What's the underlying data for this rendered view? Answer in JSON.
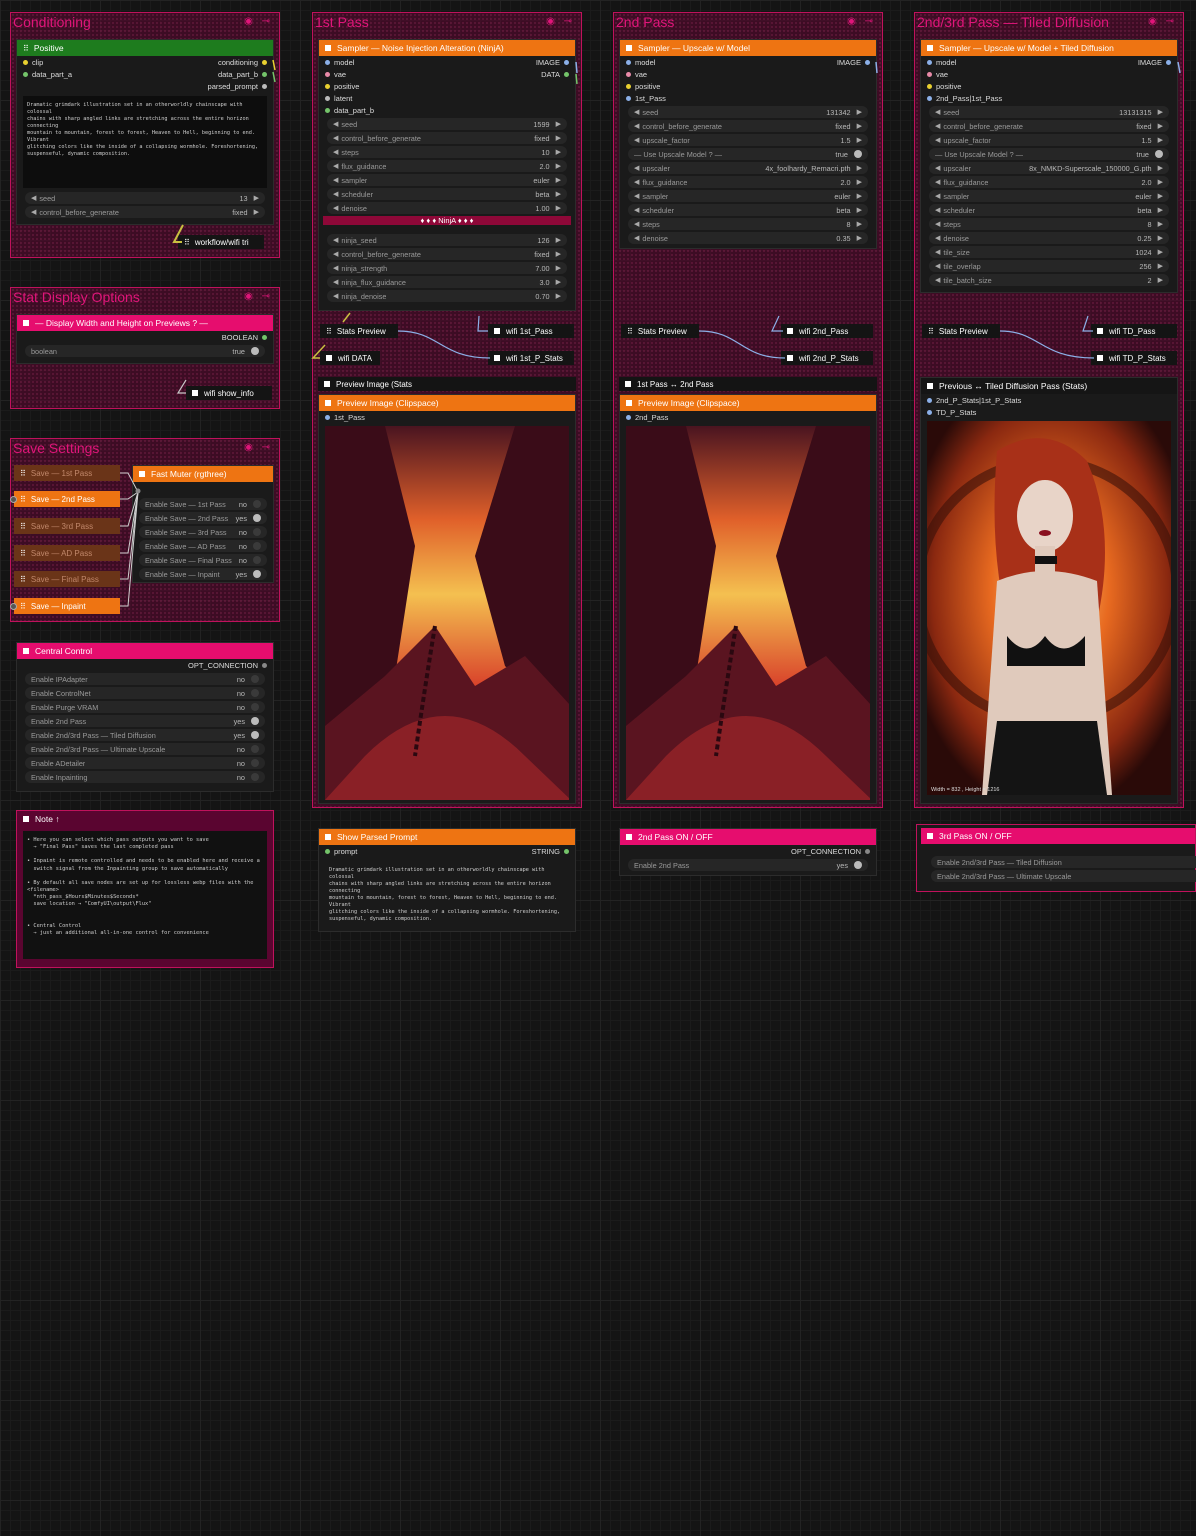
{
  "groups": {
    "conditioning": "Conditioning",
    "pass1": "1st Pass",
    "pass2": "2nd Pass",
    "pass3": "2nd/3rd Pass — Tiled Diffusion",
    "stat": "Stat Display Options",
    "save": "Save Settings",
    "group_icons": "◉ ⊸"
  },
  "positive": {
    "title": "Positive",
    "in": [
      "clip",
      "data_part_a"
    ],
    "out": [
      "conditioning",
      "data_part_b",
      "parsed_prompt"
    ],
    "prompt": "Dramatic grimdark illustration set in an otherworldly chainscape with colossal\nchains with sharp angled links are stretching across the entire horizon connecting\nmountain to mountain, forest to forest, Heaven to Hell, beginning to end. Vibrant\nglitching colors like the inside of a collapsing wormhole. Foreshortening,\nsuspenseful, dynamic composition.",
    "seed_label": "seed",
    "seed_val": "13",
    "cbg_label": "control_before_generate",
    "cbg_val": "fixed",
    "wifi": "workflow/wifi tri"
  },
  "stat_node": {
    "title": "— Display Width and Height on Previews ? —",
    "out": "BOOLEAN",
    "label": "boolean",
    "val": "true",
    "wifi": "wifi show_info"
  },
  "fast_muter": {
    "title": "Fast Muter (rgthree)",
    "items": [
      {
        "label": "Enable Save — 1st Pass",
        "val": "no"
      },
      {
        "label": "Enable Save — 2nd Pass",
        "val": "yes"
      },
      {
        "label": "Enable Save — 3rd Pass",
        "val": "no"
      },
      {
        "label": "Enable Save — AD Pass",
        "val": "no"
      },
      {
        "label": "Enable Save — Final Pass",
        "val": "no"
      },
      {
        "label": "Enable Save — Inpaint",
        "val": "yes"
      }
    ]
  },
  "save_nodes": [
    "Save — 1st Pass",
    "Save — 2nd Pass",
    "Save — 3rd Pass",
    "Save — AD Pass",
    "Save — Final Pass",
    "Save — Inpaint"
  ],
  "central": {
    "title": "Central Control",
    "out": "OPT_CONNECTION",
    "items": [
      {
        "label": "Enable IPAdapter",
        "val": "no"
      },
      {
        "label": "Enable ControlNet",
        "val": "no"
      },
      {
        "label": "Enable Purge VRAM",
        "val": "no"
      },
      {
        "label": "Enable 2nd Pass",
        "val": "yes"
      },
      {
        "label": "Enable 2nd/3rd Pass — Tiled Diffusion",
        "val": "yes"
      },
      {
        "label": "Enable 2nd/3rd Pass — Ultimate Upscale",
        "val": "no"
      },
      {
        "label": "Enable ADetailer",
        "val": "no"
      },
      {
        "label": "Enable Inpainting",
        "val": "no"
      }
    ]
  },
  "note": {
    "title": "Note ↑",
    "text": "• Here you can select which pass outputs you want to save\n  → \"Final Pass\" saves the last completed pass\n\n• Inpaint is remote controlled and needs to be enabled here and receive a\n  switch signal from the Inpainting group to save automatically\n\n• By default all save nodes are set up for lossless webp files with the <filename>\n  *nth_pass_$Hours$Minutes$Seconds*\n  save location → \"ComfyUI\\output\\Flux\"\n\n\n• Central Control\n  → just an additional all-in-one control for convenience"
  },
  "ninja": {
    "title": "Sampler — Noise Injection Alteration (NinjA)",
    "inputs": [
      "model",
      "vae",
      "positive",
      "latent",
      "data_part_b"
    ],
    "outputs": [
      "IMAGE",
      "DATA"
    ],
    "w1": [
      {
        "label": "seed",
        "val": "1599"
      },
      {
        "label": "control_before_generate",
        "val": "fixed"
      },
      {
        "label": "steps",
        "val": "10"
      },
      {
        "label": "flux_guidance",
        "val": "2.0"
      },
      {
        "label": "sampler",
        "val": "euler"
      },
      {
        "label": "scheduler",
        "val": "beta"
      },
      {
        "label": "denoise",
        "val": "1.00"
      }
    ],
    "banner": "♦ ♦ ♦ NinjA ♦ ♦ ♦",
    "w2": [
      {
        "label": "ninja_seed",
        "val": "126"
      },
      {
        "label": "control_before_generate",
        "val": "fixed"
      },
      {
        "label": "ninja_strength",
        "val": "7.00"
      },
      {
        "label": "ninja_flux_guidance",
        "val": "3.0"
      },
      {
        "label": "ninja_denoise",
        "val": "0.70"
      }
    ]
  },
  "p1": {
    "stats": "Stats Preview",
    "wifi1": "wifi 1st_Pass",
    "wifi_data": "wifi DATA",
    "wifi2": "wifi 1st_P_Stats",
    "stats_node": "Preview Image (Stats",
    "preview_title": "Preview Image (Clipspace)",
    "preview_in": "1st_Pass"
  },
  "parsed": {
    "title": "Show Parsed Prompt",
    "in": "prompt",
    "out": "STRING",
    "text": "Dramatic grimdark illustration set in an otherworldly chainscape with colossal\nchains with sharp angled links are stretching across the entire horizon connecting\nmountain to mountain, forest to forest, Heaven to Hell, beginning to end. Vibrant\nglitching colors like the inside of a collapsing wormhole. Foreshortening,\nsuspenseful, dynamic composition."
  },
  "upscale": {
    "title": "Sampler — Upscale w/ Model",
    "inputs": [
      "model",
      "vae",
      "positive",
      "1st_Pass"
    ],
    "out": "IMAGE",
    "widgets": [
      {
        "label": "seed",
        "val": "131342",
        "kind": "num"
      },
      {
        "label": "control_before_generate",
        "val": "fixed",
        "kind": "num"
      },
      {
        "label": "upscale_factor",
        "val": "1.5",
        "kind": "num"
      },
      {
        "label": "— Use Upscale Model ? —",
        "val": "true",
        "kind": "tog"
      },
      {
        "label": "upscaler",
        "val": "4x_foolhardy_Remacri.pth",
        "kind": "num"
      },
      {
        "label": "flux_guidance",
        "val": "2.0",
        "kind": "num"
      },
      {
        "label": "sampler",
        "val": "euler",
        "kind": "num"
      },
      {
        "label": "scheduler",
        "val": "beta",
        "kind": "num"
      },
      {
        "label": "steps",
        "val": "8",
        "kind": "num"
      },
      {
        "label": "denoise",
        "val": "0.35",
        "kind": "num"
      }
    ]
  },
  "p2": {
    "stats": "Stats Preview",
    "wifi1": "wifi 2nd_Pass",
    "wifi2": "wifi 2nd_P_Stats",
    "compare": "1st Pass ↔ 2nd Pass",
    "preview_title": "Preview Image (Clipspace)",
    "preview_in": "2nd_Pass"
  },
  "switch2": {
    "title": "2nd Pass  ON / OFF",
    "out": "OPT_CONNECTION",
    "label": "Enable 2nd Pass",
    "val": "yes"
  },
  "tiled": {
    "title": "Sampler — Upscale w/ Model + Tiled Diffusion",
    "inputs": [
      "model",
      "vae",
      "positive",
      "2nd_Pass|1st_Pass"
    ],
    "out": "IMAGE",
    "widgets": [
      {
        "label": "seed",
        "val": "13131315",
        "kind": "num"
      },
      {
        "label": "control_before_generate",
        "val": "fixed",
        "kind": "num"
      },
      {
        "label": "upscale_factor",
        "val": "1.5",
        "kind": "num"
      },
      {
        "label": "— Use Upscale Model ? —",
        "val": "true",
        "kind": "tog"
      },
      {
        "label": "upscaler",
        "val": "8x_NMKD-Superscale_150000_G.pth",
        "kind": "num"
      },
      {
        "label": "flux_guidance",
        "val": "2.0",
        "kind": "num"
      },
      {
        "label": "sampler",
        "val": "euler",
        "kind": "num"
      },
      {
        "label": "scheduler",
        "val": "beta",
        "kind": "num"
      },
      {
        "label": "steps",
        "val": "8",
        "kind": "num"
      },
      {
        "label": "denoise",
        "val": "0.25",
        "kind": "num"
      },
      {
        "label": "tile_size",
        "val": "1024",
        "kind": "num"
      },
      {
        "label": "tile_overlap",
        "val": "256",
        "kind": "num"
      },
      {
        "label": "tile_batch_size",
        "val": "2",
        "kind": "num"
      }
    ]
  },
  "p3": {
    "stats": "Stats Preview",
    "wifi1": "wifi TD_Pass",
    "wifi2": "wifi TD_P_Stats",
    "compare": "Previous ↔ Tiled Diffusion Pass (Stats)",
    "in1": "2nd_P_Stats|1st_P_Stats",
    "in2": "TD_P_Stats",
    "dims": "Width = 832 , Height = 1216"
  },
  "switch3": {
    "title": "3rd Pass  ON / OFF",
    "items": [
      "Enable 2nd/3rd Pass — Tiled Diffusion",
      "Enable 2nd/3rd Pass — Ultimate Upscale"
    ]
  }
}
